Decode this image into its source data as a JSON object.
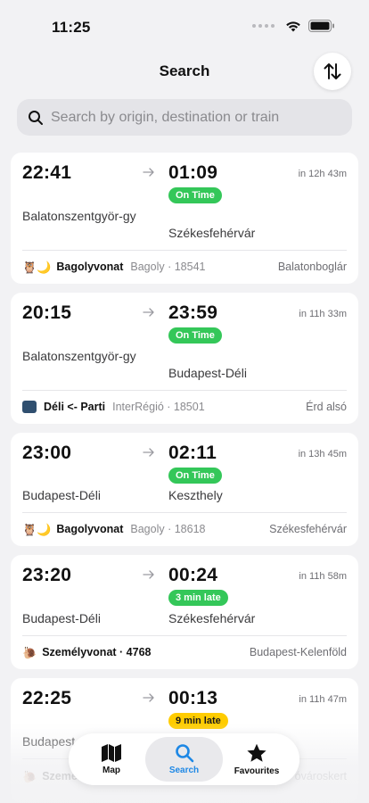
{
  "status_bar": {
    "time": "11:25"
  },
  "header": {
    "title": "Search"
  },
  "search": {
    "placeholder": "Search by origin, destination or train"
  },
  "connections": [
    {
      "departure": "22:41",
      "arrival": "01:09",
      "eta": "in 12h 43m",
      "status": "On Time",
      "status_color": "#34c759",
      "origin": "Balatonszentgyör-gy",
      "destination": "Székesfehérvár",
      "train_icon": "owl-moon-icon",
      "train_emoji": "🦉🌙",
      "train_name": "Bagolyvonat",
      "train_meta": "Bagoly · 18541",
      "train_destination": "Balatonboglár"
    },
    {
      "departure": "20:15",
      "arrival": "23:59",
      "eta": "in 11h 33m",
      "status": "On Time",
      "status_color": "#34c759",
      "origin": "Balatonszentgyör-gy",
      "destination": "Budapest-Déli",
      "train_icon": "intercity-train-icon",
      "train_emoji": "",
      "train_name": "Déli <- Parti",
      "train_meta": "InterRégió · 18501",
      "train_destination": "Érd alsó"
    },
    {
      "departure": "23:00",
      "arrival": "02:11",
      "eta": "in 13h 45m",
      "status": "On Time",
      "status_color": "#34c759",
      "origin": "Budapest-Déli",
      "destination": "Keszthely",
      "train_icon": "owl-moon-icon",
      "train_emoji": "🦉🌙",
      "train_name": "Bagolyvonat",
      "train_meta": "Bagoly · 18618",
      "train_destination": "Székesfehérvár"
    },
    {
      "departure": "23:20",
      "arrival": "00:24",
      "eta": "in 11h 58m",
      "status": "3 min late",
      "status_color": "#34c759",
      "origin": "Budapest-Déli",
      "destination": "Székesfehérvár",
      "train_icon": "snail-icon",
      "train_emoji": "🐌",
      "train_name": "Személyvonat · 4768",
      "train_meta": "",
      "train_destination": "Budapest-Kelenföld"
    },
    {
      "departure": "22:25",
      "arrival": "00:13",
      "eta": "in 11h 47m",
      "status": "9 min late",
      "status_color": "#ffcc00",
      "origin": "Budapest",
      "destination": "",
      "train_icon": "snail-icon",
      "train_emoji": "🐌",
      "train_name": "Szeme",
      "train_meta": "",
      "train_destination": "óvároskert"
    }
  ],
  "tab_bar": {
    "items": [
      {
        "label": "Map",
        "icon": "map-icon"
      },
      {
        "label": "Search",
        "icon": "search-icon",
        "active": true
      },
      {
        "label": "Favourites",
        "icon": "star-icon"
      }
    ],
    "active_color": "#1e88e5"
  }
}
